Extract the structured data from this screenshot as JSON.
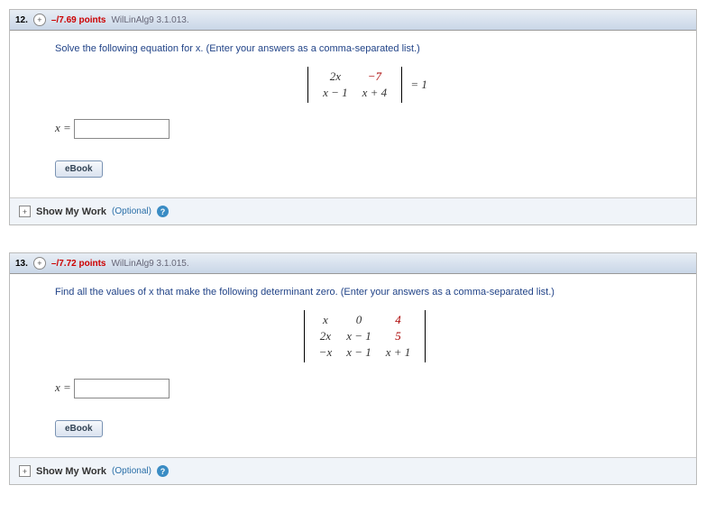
{
  "questions": [
    {
      "number": "12.",
      "points": "–/7.69 points",
      "source": "WilLinAlg9 3.1.013.",
      "prompt": "Solve the following equation for x. (Enter your answers as a comma-separated list.)",
      "answer_label": "x =",
      "ebook": "eBook",
      "smw": {
        "label": "Show My Work",
        "optional": "(Optional)"
      },
      "matrix": {
        "rows": [
          [
            "2x",
            "−7"
          ],
          [
            "x − 1",
            "x + 4"
          ]
        ],
        "red_map": [
          [
            0,
            1
          ]
        ],
        "rhs": "= 1"
      }
    },
    {
      "number": "13.",
      "points": "–/7.72 points",
      "source": "WilLinAlg9 3.1.015.",
      "prompt": "Find all the values of x that make the following determinant zero. (Enter your answers as a comma-separated list.)",
      "answer_label": "x =",
      "ebook": "eBook",
      "smw": {
        "label": "Show My Work",
        "optional": "(Optional)"
      },
      "matrix": {
        "rows": [
          [
            "x",
            "0",
            "4"
          ],
          [
            "2x",
            "x − 1",
            "5"
          ],
          [
            "−x",
            "x − 1",
            "x + 1"
          ]
        ],
        "red_map": [
          [
            0,
            2
          ],
          [
            1,
            2
          ]
        ],
        "rhs": ""
      }
    }
  ]
}
